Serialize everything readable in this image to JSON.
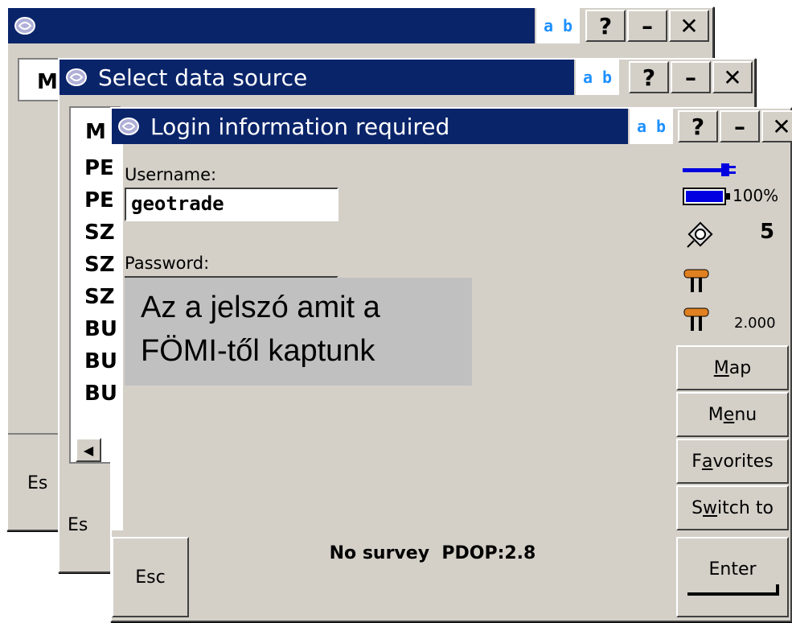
{
  "back_window": {
    "title": "",
    "col_header": "M",
    "esc_label": "Es"
  },
  "mid_window": {
    "title": "Select data source",
    "col_header": "M",
    "esc_label": "Es"
  },
  "front_window": {
    "title": "Login information required",
    "ab_label": "a b",
    "help_label": "?",
    "min_label": "–",
    "close_label": "✕",
    "list_items": [
      "PE",
      "PE",
      "SZ",
      "SZ",
      "SZ",
      "BU",
      "BU",
      "BU"
    ],
    "username_label": "Username:",
    "username_value": "geotrade",
    "password_label": "Password:",
    "password_value": "",
    "status_text": "No survey  PDOP:2.8",
    "esc_label": "Esc",
    "enter_label": "Enter"
  },
  "status_panel": {
    "battery_percent": "100%",
    "satellite_count": "5",
    "antenna_height": "2.000"
  },
  "side_buttons": [
    {
      "label_pre": "",
      "label_u": "M",
      "label_post": "ap"
    },
    {
      "label_pre": "M",
      "label_u": "e",
      "label_post": "nu"
    },
    {
      "label_pre": "F",
      "label_u": "a",
      "label_post": "vorites"
    },
    {
      "label_pre": "S",
      "label_u": "w",
      "label_post": "itch to"
    }
  ],
  "annotation": {
    "line1": "Az a jelszó amit a",
    "line2": "FÖMI-től kaptunk"
  },
  "colors": {
    "titlebar": "#0a246a",
    "face": "#d4d0c8",
    "annotation_bg": "#c0c0c0"
  }
}
